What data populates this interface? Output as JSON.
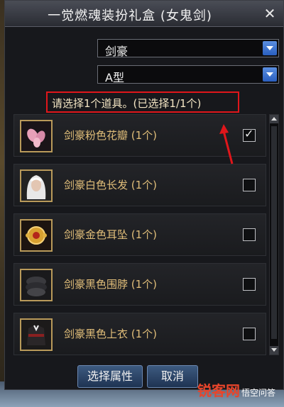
{
  "window": {
    "title": "一觉燃魂装扮礼盒 (女鬼剑)",
    "close_glyph": "✕"
  },
  "dropdowns": {
    "job": "剑豪",
    "type": "A型"
  },
  "prompt": "请选择1个道具。(已选择1/1个)",
  "items": [
    {
      "label": "剑豪粉色花瓣 (1个)",
      "checked": true,
      "icon": "petal-icon"
    },
    {
      "label": "剑豪白色长发 (1个)",
      "checked": false,
      "icon": "hair-icon"
    },
    {
      "label": "剑豪金色耳坠 (1个)",
      "checked": false,
      "icon": "earring-icon"
    },
    {
      "label": "剑豪黑色围脖 (1个)",
      "checked": false,
      "icon": "scarf-icon"
    },
    {
      "label": "剑豪黑色上衣 (1个)",
      "checked": false,
      "icon": "top-icon"
    }
  ],
  "footer": {
    "select_attr": "选择属性",
    "cancel": "取消"
  },
  "watermark": {
    "main": "锐客网",
    "sub": "悟空问答"
  },
  "colors": {
    "highlight_box": "#e0161b",
    "item_text": "#e0bd79",
    "button": "#2f4b72"
  }
}
